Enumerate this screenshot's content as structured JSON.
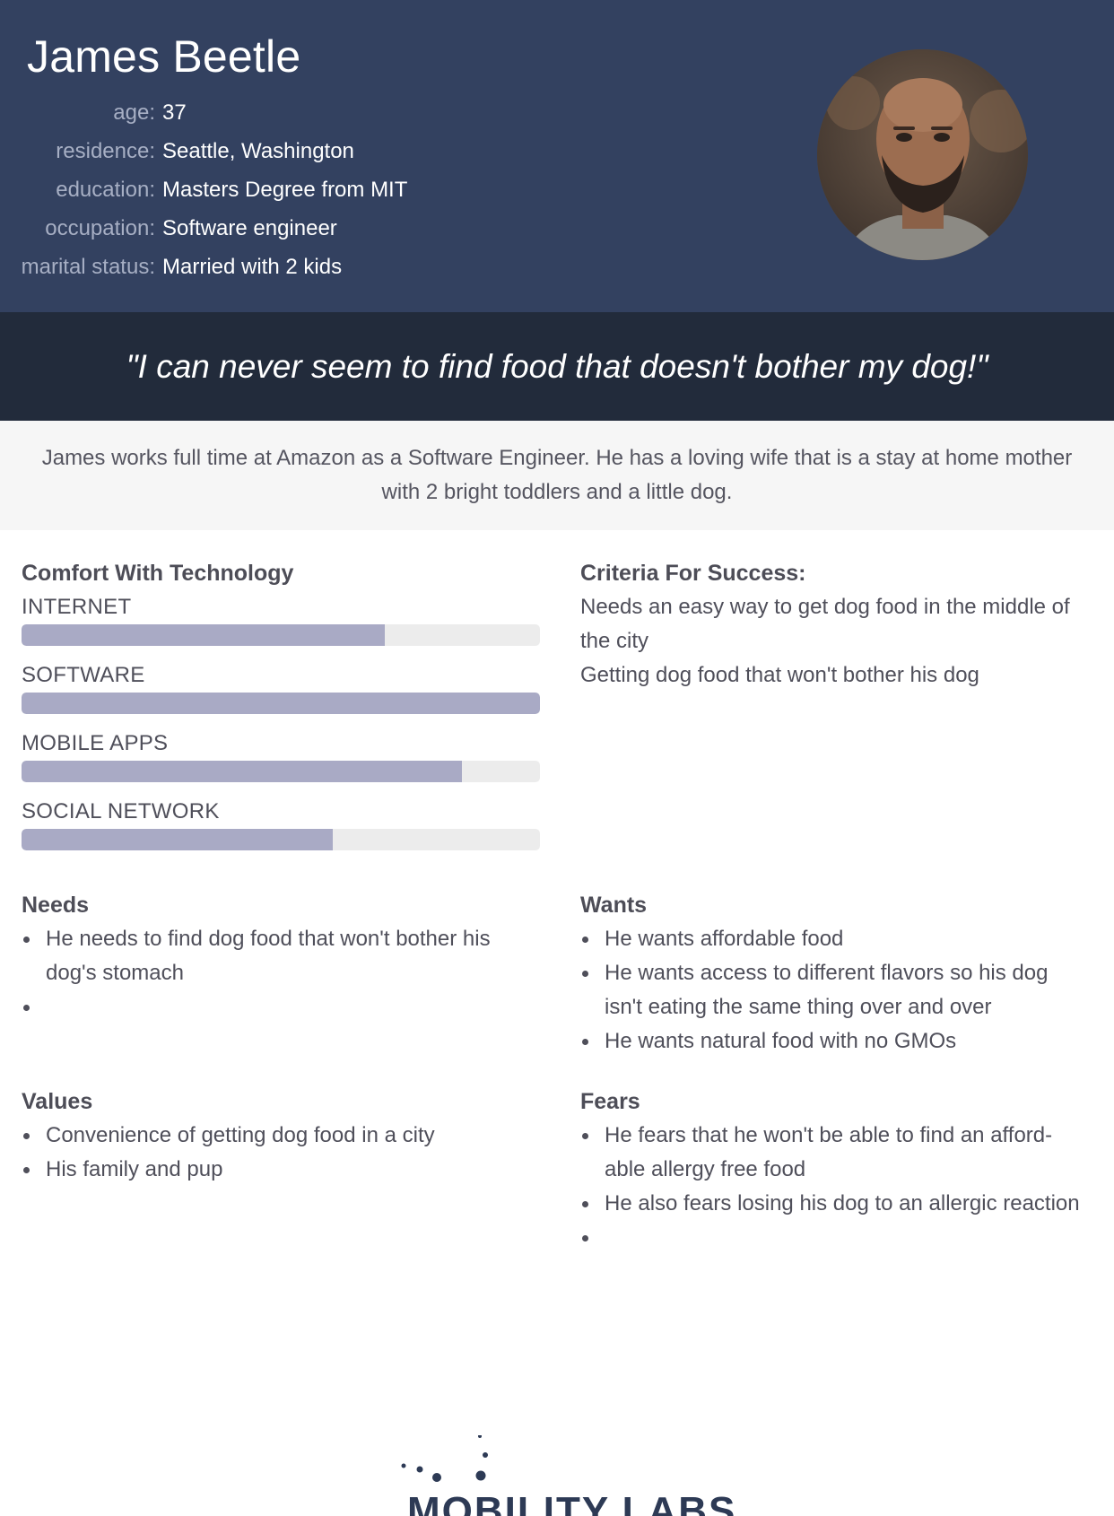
{
  "header": {
    "name": "James Beetle",
    "attributes": [
      {
        "label": "age:",
        "value": "37"
      },
      {
        "label": "residence:",
        "value": "Seattle, Washington"
      },
      {
        "label": "education:",
        "value": "Masters Degree from MIT"
      },
      {
        "label": "occupation:",
        "value": "Software engineer"
      },
      {
        "label": "marital status:",
        "value": "Married with 2 kids"
      }
    ]
  },
  "quote": "\"I can never seem to find food that doesn't bother my dog!\"",
  "bio": "James works full time at Amazon as a Software Engineer. He has a loving wife that is a stay at home mother with 2 bright toddlers and a little dog.",
  "technology": {
    "title": "Comfort With Technology",
    "items": [
      {
        "label": "INTERNET",
        "level": 0.7
      },
      {
        "label": "SOFTWARE",
        "level": 1.0
      },
      {
        "label": "MOBILE APPS",
        "level": 0.85
      },
      {
        "label": "SOCIAL NETWORK",
        "level": 0.6
      }
    ]
  },
  "criteria": {
    "title": "Criteria For Success:",
    "lines": [
      "Needs an easy way to get dog food in the middle of the city",
      "Getting dog food that won't bother his dog"
    ]
  },
  "needs": {
    "title": "Needs",
    "items": [
      "He needs to find dog food that won't bother his dog's stomach",
      ""
    ]
  },
  "wants": {
    "title": "Wants",
    "items": [
      "He wants affordable food",
      "He wants access to different flavors so his dog isn't eating the same thing over and over",
      "He wants natural food with no GMOs"
    ]
  },
  "values": {
    "title": "Values",
    "items": [
      "Convenience of getting dog food in a city",
      "His family and pup"
    ]
  },
  "fears": {
    "title": "Fears",
    "items": [
      "He fears that he won't be able to find an afford-able allergy free food",
      "He also fears losing his dog to an allergic reaction",
      ""
    ]
  },
  "logo": {
    "text": "MOBILITY LABS"
  },
  "colors": {
    "header": "#334160",
    "quote_band": "#222b3b",
    "bar_fill": "#a9aac5",
    "bar_track": "#ececec"
  }
}
